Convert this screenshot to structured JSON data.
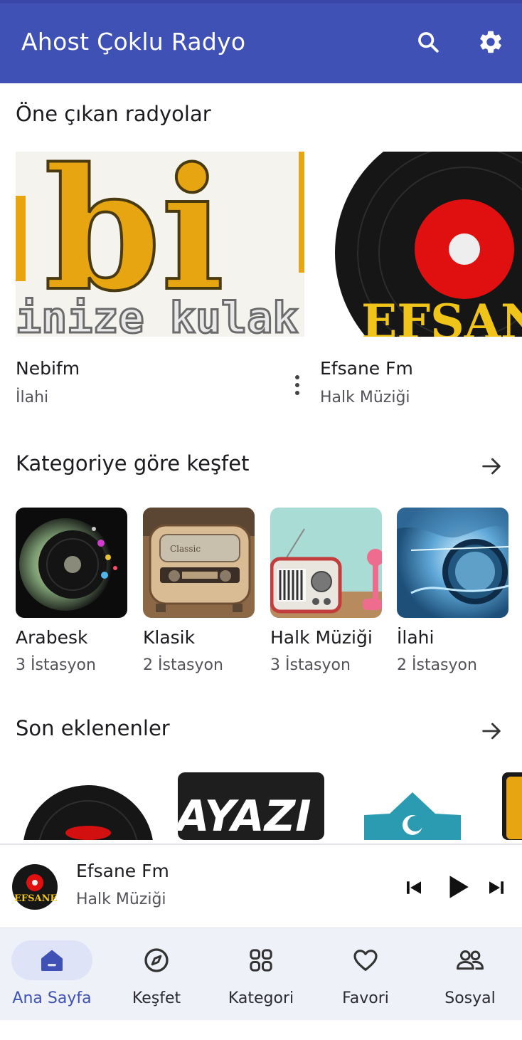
{
  "app": {
    "title": "Ahost Çoklu Radyo"
  },
  "colors": {
    "primary": "#3f51b5",
    "nav_active_bg": "#dfe3f7",
    "nav_bg": "#eef1f7"
  },
  "icons": {
    "search": "search-icon",
    "settings": "gear-icon",
    "arrow": "arrow-right-icon",
    "more": "more-vert-icon"
  },
  "featured": {
    "title": "Öne çıkan radyolar",
    "items": [
      {
        "name": "Nebifm",
        "genre": "İlahi",
        "logo_text_top": "bi",
        "logo_text_bottom": "inize kulak"
      },
      {
        "name": "Efsane Fm",
        "genre": "Halk Müziği",
        "logo_text": "EFSANE"
      }
    ]
  },
  "categories": {
    "title": "Kategoriye göre keşfet",
    "items": [
      {
        "name": "Arabesk",
        "count": "3 İstasyon"
      },
      {
        "name": "Klasik",
        "count": "2 İstasyon"
      },
      {
        "name": "Halk Müziği",
        "count": "3 İstasyon"
      },
      {
        "name": "İlahi",
        "count": "2 İstasyon"
      }
    ]
  },
  "recent": {
    "title": "Son eklenenler",
    "items": [
      {
        "name": "vinyl"
      },
      {
        "name": "AYAZI",
        "logo_text": "AYAZI"
      },
      {
        "name": "mosque"
      },
      {
        "name": "partial"
      }
    ]
  },
  "player": {
    "station": "Efsane Fm",
    "genre": "Halk Müziği",
    "thumb_text": "EFSANE"
  },
  "bottom_nav": {
    "items": [
      {
        "label": "Ana Sayfa",
        "icon": "home-icon",
        "active": true
      },
      {
        "label": "Keşfet",
        "icon": "compass-icon",
        "active": false
      },
      {
        "label": "Kategori",
        "icon": "grid-icon",
        "active": false
      },
      {
        "label": "Favori",
        "icon": "heart-icon",
        "active": false
      },
      {
        "label": "Sosyal",
        "icon": "people-icon",
        "active": false
      }
    ]
  }
}
